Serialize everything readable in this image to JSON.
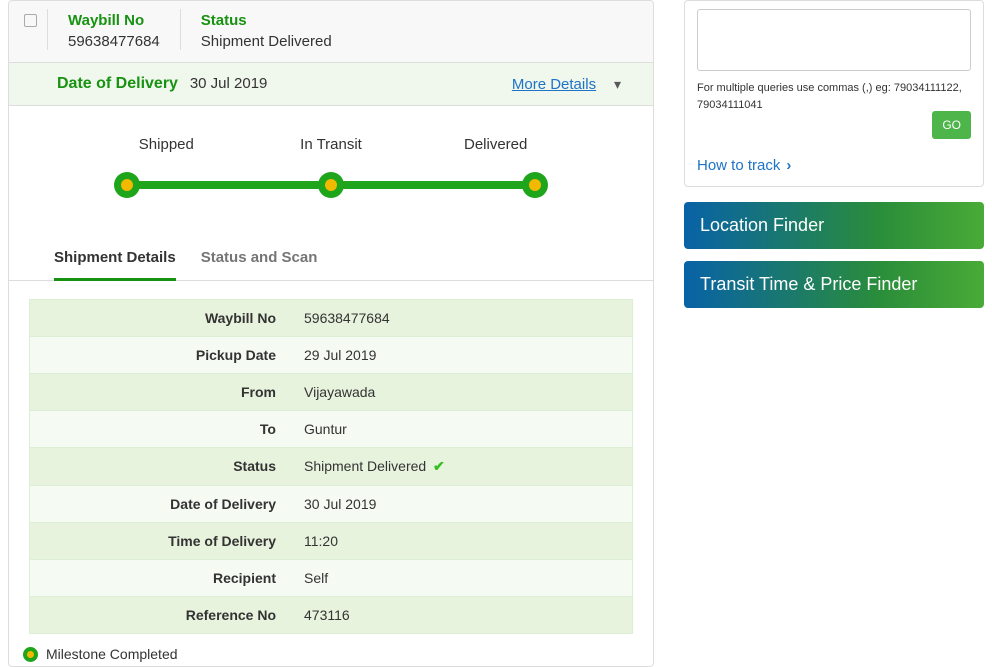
{
  "header": {
    "waybill_label": "Waybill No",
    "waybill_value": "59638477684",
    "status_label": "Status",
    "status_value": "Shipment Delivered"
  },
  "date_row": {
    "label": "Date of Delivery",
    "value": "30 Jul 2019",
    "more_details": "More Details"
  },
  "progress": {
    "stages": [
      "Shipped",
      "In Transit",
      "Delivered"
    ]
  },
  "tabs": {
    "shipment_details": "Shipment Details",
    "status_scan": "Status and Scan"
  },
  "details": [
    {
      "label": "Waybill No",
      "value": "59638477684"
    },
    {
      "label": "Pickup Date",
      "value": "29 Jul 2019"
    },
    {
      "label": "From",
      "value": "Vijayawada"
    },
    {
      "label": "To",
      "value": "Guntur"
    },
    {
      "label": "Status",
      "value": "Shipment Delivered",
      "check": true
    },
    {
      "label": "Date of Delivery",
      "value": "30 Jul 2019"
    },
    {
      "label": "Time of Delivery",
      "value": "11:20"
    },
    {
      "label": "Recipient",
      "value": "Self"
    },
    {
      "label": "Reference No",
      "value": "473116"
    }
  ],
  "milestone": "Milestone Completed",
  "search": {
    "hint": "For multiple queries use commas (,) eg: 79034111122, 79034111041",
    "go": "GO",
    "howto": "How to track"
  },
  "ctas": {
    "location": "Location Finder",
    "transit": "Transit Time & Price Finder"
  }
}
